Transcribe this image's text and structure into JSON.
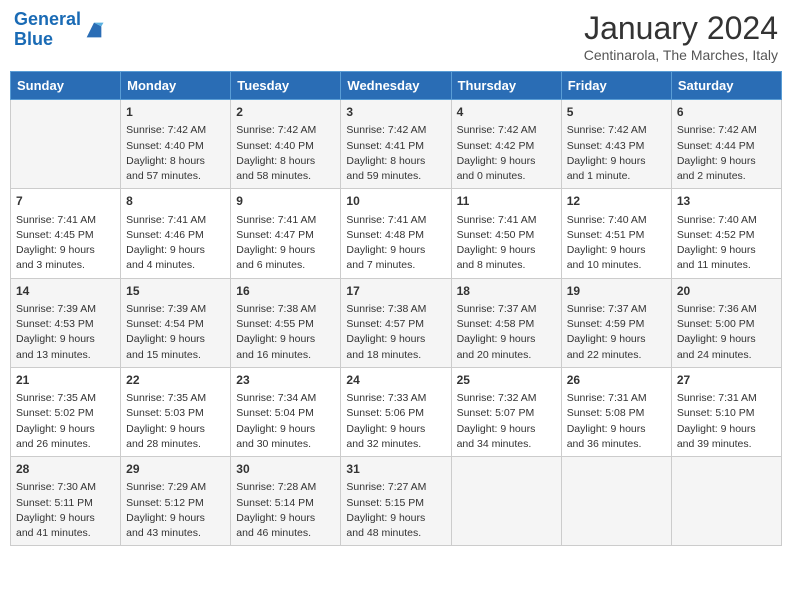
{
  "header": {
    "logo_line1": "General",
    "logo_line2": "Blue",
    "month": "January 2024",
    "location": "Centinarola, The Marches, Italy"
  },
  "weekdays": [
    "Sunday",
    "Monday",
    "Tuesday",
    "Wednesday",
    "Thursday",
    "Friday",
    "Saturday"
  ],
  "weeks": [
    [
      {
        "day": "",
        "info": ""
      },
      {
        "day": "1",
        "info": "Sunrise: 7:42 AM\nSunset: 4:40 PM\nDaylight: 8 hours\nand 57 minutes."
      },
      {
        "day": "2",
        "info": "Sunrise: 7:42 AM\nSunset: 4:40 PM\nDaylight: 8 hours\nand 58 minutes."
      },
      {
        "day": "3",
        "info": "Sunrise: 7:42 AM\nSunset: 4:41 PM\nDaylight: 8 hours\nand 59 minutes."
      },
      {
        "day": "4",
        "info": "Sunrise: 7:42 AM\nSunset: 4:42 PM\nDaylight: 9 hours\nand 0 minutes."
      },
      {
        "day": "5",
        "info": "Sunrise: 7:42 AM\nSunset: 4:43 PM\nDaylight: 9 hours\nand 1 minute."
      },
      {
        "day": "6",
        "info": "Sunrise: 7:42 AM\nSunset: 4:44 PM\nDaylight: 9 hours\nand 2 minutes."
      }
    ],
    [
      {
        "day": "7",
        "info": "Sunrise: 7:41 AM\nSunset: 4:45 PM\nDaylight: 9 hours\nand 3 minutes."
      },
      {
        "day": "8",
        "info": "Sunrise: 7:41 AM\nSunset: 4:46 PM\nDaylight: 9 hours\nand 4 minutes."
      },
      {
        "day": "9",
        "info": "Sunrise: 7:41 AM\nSunset: 4:47 PM\nDaylight: 9 hours\nand 6 minutes."
      },
      {
        "day": "10",
        "info": "Sunrise: 7:41 AM\nSunset: 4:48 PM\nDaylight: 9 hours\nand 7 minutes."
      },
      {
        "day": "11",
        "info": "Sunrise: 7:41 AM\nSunset: 4:50 PM\nDaylight: 9 hours\nand 8 minutes."
      },
      {
        "day": "12",
        "info": "Sunrise: 7:40 AM\nSunset: 4:51 PM\nDaylight: 9 hours\nand 10 minutes."
      },
      {
        "day": "13",
        "info": "Sunrise: 7:40 AM\nSunset: 4:52 PM\nDaylight: 9 hours\nand 11 minutes."
      }
    ],
    [
      {
        "day": "14",
        "info": "Sunrise: 7:39 AM\nSunset: 4:53 PM\nDaylight: 9 hours\nand 13 minutes."
      },
      {
        "day": "15",
        "info": "Sunrise: 7:39 AM\nSunset: 4:54 PM\nDaylight: 9 hours\nand 15 minutes."
      },
      {
        "day": "16",
        "info": "Sunrise: 7:38 AM\nSunset: 4:55 PM\nDaylight: 9 hours\nand 16 minutes."
      },
      {
        "day": "17",
        "info": "Sunrise: 7:38 AM\nSunset: 4:57 PM\nDaylight: 9 hours\nand 18 minutes."
      },
      {
        "day": "18",
        "info": "Sunrise: 7:37 AM\nSunset: 4:58 PM\nDaylight: 9 hours\nand 20 minutes."
      },
      {
        "day": "19",
        "info": "Sunrise: 7:37 AM\nSunset: 4:59 PM\nDaylight: 9 hours\nand 22 minutes."
      },
      {
        "day": "20",
        "info": "Sunrise: 7:36 AM\nSunset: 5:00 PM\nDaylight: 9 hours\nand 24 minutes."
      }
    ],
    [
      {
        "day": "21",
        "info": "Sunrise: 7:35 AM\nSunset: 5:02 PM\nDaylight: 9 hours\nand 26 minutes."
      },
      {
        "day": "22",
        "info": "Sunrise: 7:35 AM\nSunset: 5:03 PM\nDaylight: 9 hours\nand 28 minutes."
      },
      {
        "day": "23",
        "info": "Sunrise: 7:34 AM\nSunset: 5:04 PM\nDaylight: 9 hours\nand 30 minutes."
      },
      {
        "day": "24",
        "info": "Sunrise: 7:33 AM\nSunset: 5:06 PM\nDaylight: 9 hours\nand 32 minutes."
      },
      {
        "day": "25",
        "info": "Sunrise: 7:32 AM\nSunset: 5:07 PM\nDaylight: 9 hours\nand 34 minutes."
      },
      {
        "day": "26",
        "info": "Sunrise: 7:31 AM\nSunset: 5:08 PM\nDaylight: 9 hours\nand 36 minutes."
      },
      {
        "day": "27",
        "info": "Sunrise: 7:31 AM\nSunset: 5:10 PM\nDaylight: 9 hours\nand 39 minutes."
      }
    ],
    [
      {
        "day": "28",
        "info": "Sunrise: 7:30 AM\nSunset: 5:11 PM\nDaylight: 9 hours\nand 41 minutes."
      },
      {
        "day": "29",
        "info": "Sunrise: 7:29 AM\nSunset: 5:12 PM\nDaylight: 9 hours\nand 43 minutes."
      },
      {
        "day": "30",
        "info": "Sunrise: 7:28 AM\nSunset: 5:14 PM\nDaylight: 9 hours\nand 46 minutes."
      },
      {
        "day": "31",
        "info": "Sunrise: 7:27 AM\nSunset: 5:15 PM\nDaylight: 9 hours\nand 48 minutes."
      },
      {
        "day": "",
        "info": ""
      },
      {
        "day": "",
        "info": ""
      },
      {
        "day": "",
        "info": ""
      }
    ]
  ]
}
